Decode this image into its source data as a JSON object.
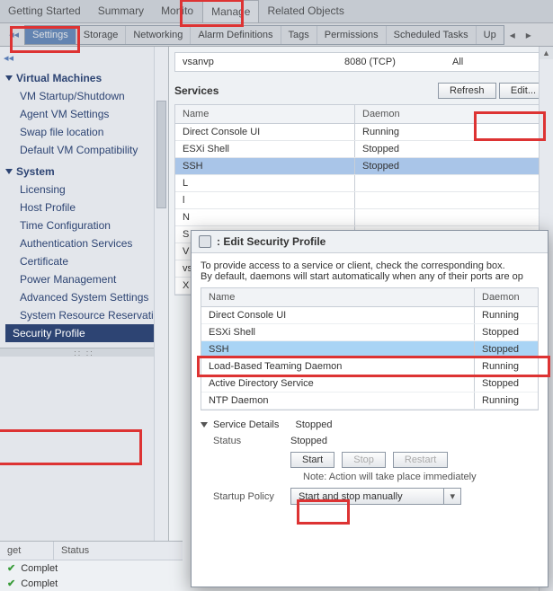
{
  "topnav": {
    "tabs": [
      "Getting Started",
      "Summary",
      "Monito",
      "Manage",
      "Related Objects"
    ],
    "active": 3
  },
  "subnav": {
    "lead_glyph": "◂◂",
    "tabs": [
      "Settings",
      "Storage",
      "Networking",
      "Alarm Definitions",
      "Tags",
      "Permissions",
      "Scheduled Tasks",
      "Up"
    ],
    "selected": 0,
    "right_nav": "▸"
  },
  "sidebar": {
    "lead_glyph": "◂◂",
    "groups": [
      {
        "title": "Virtual Machines",
        "items": [
          "VM Startup/Shutdown",
          "Agent VM Settings",
          "Swap file location",
          "Default VM Compatibility"
        ]
      },
      {
        "title": "System",
        "items": [
          "Licensing",
          "Host Profile",
          "Time Configuration",
          "Authentication Services",
          "Certificate",
          "Power Management",
          "Advanced System Settings",
          "System Resource Reservation",
          "Security Profile"
        ],
        "selected": 8
      }
    ],
    "slider_glyph": "::          ::"
  },
  "content": {
    "port_row": {
      "name": "vsanvp",
      "port": "8080 (TCP)",
      "allowed": "All"
    },
    "services_title": "Services",
    "buttons": {
      "refresh": "Refresh",
      "edit": "Edit..."
    },
    "service_table": {
      "headers": {
        "name": "Name",
        "daemon": "Daemon"
      },
      "rows": [
        {
          "name": "Direct Console UI",
          "daemon": "Running"
        },
        {
          "name": "ESXi Shell",
          "daemon": "Stopped"
        },
        {
          "name": "SSH",
          "daemon": "Stopped",
          "selected": true
        },
        {
          "name": "L",
          "daemon": ""
        },
        {
          "name": "l",
          "daemon": ""
        },
        {
          "name": "N",
          "daemon": ""
        },
        {
          "name": "S",
          "daemon": ""
        },
        {
          "name": "V",
          "daemon": ""
        },
        {
          "name": "vs",
          "daemon": ""
        },
        {
          "name": "X",
          "daemon": ""
        }
      ]
    }
  },
  "modal": {
    "title": ": Edit Security Profile",
    "intro1": "To provide access to a service or client, check the corresponding box.",
    "intro2": "By default, daemons will start automatically when any of their ports are op",
    "headers": {
      "name": "Name",
      "daemon": "Daemon"
    },
    "rows": [
      {
        "name": "Direct Console UI",
        "daemon": "Running"
      },
      {
        "name": "ESXi Shell",
        "daemon": "Stopped"
      },
      {
        "name": "SSH",
        "daemon": "Stopped",
        "selected": true
      },
      {
        "name": "Load-Based Teaming Daemon",
        "daemon": "Running"
      },
      {
        "name": "Active Directory Service",
        "daemon": "Stopped"
      },
      {
        "name": "NTP Daemon",
        "daemon": "Running"
      }
    ],
    "details": {
      "header": "Service Details",
      "header_val": "Stopped",
      "status_label": "Status",
      "status_value": "Stopped",
      "buttons": {
        "start": "Start",
        "stop": "Stop",
        "restart": "Restart"
      },
      "note": "Note: Action will take place immediately",
      "startup_label": "Startup Policy",
      "startup_value": "Start and stop manually",
      "dropdown_glyph": "▾"
    }
  },
  "tasks": {
    "headers": {
      "target": "get",
      "status": "Status"
    },
    "rows": [
      {
        "icon": "✔",
        "status": "Complet"
      },
      {
        "icon": "✔",
        "status": "Complet"
      }
    ]
  }
}
